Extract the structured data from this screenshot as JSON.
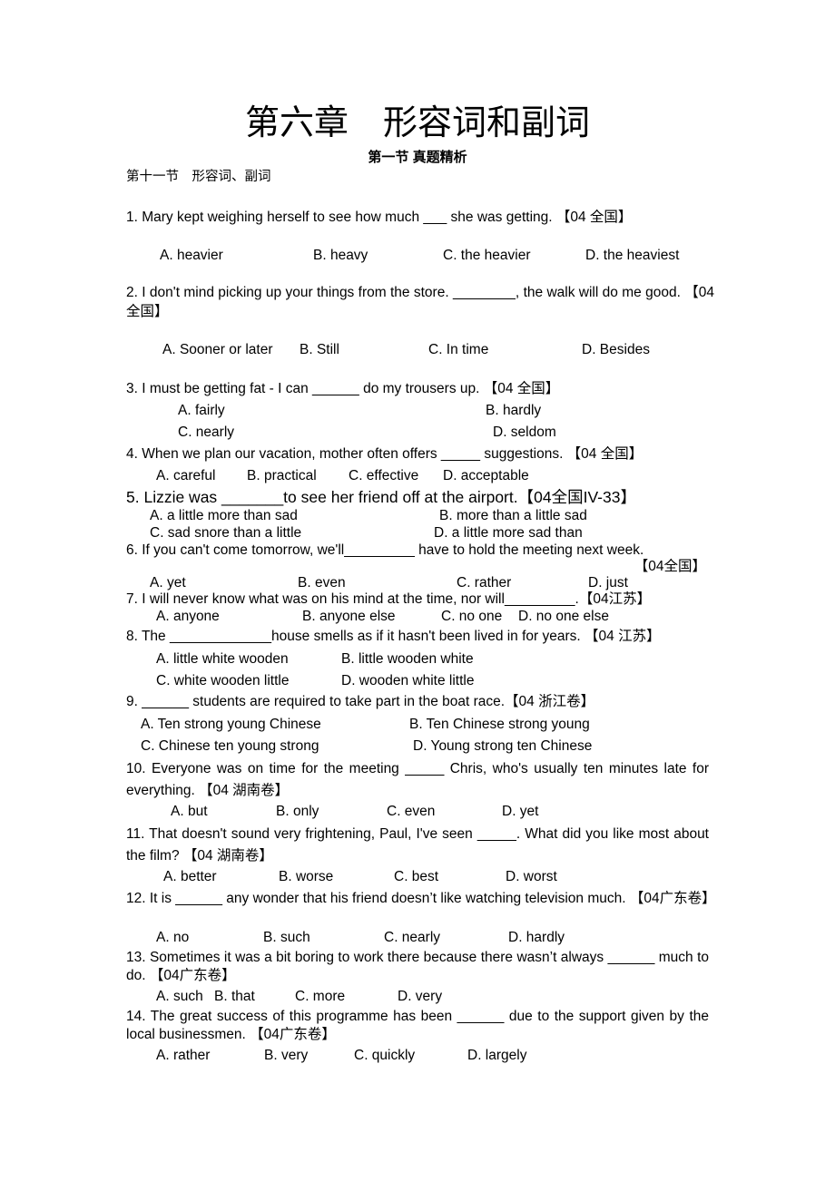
{
  "header": {
    "title": "第六章　形容词和副词",
    "subtitle": "第一节 真题精析",
    "section": "第十一节　形容词、副词"
  },
  "questions": [
    {
      "stem": "1. Mary kept weighing herself to see how much ___ she was getting.  【04 全国】",
      "options": [
        "A. heavier",
        "B. heavy",
        "C. the heavier",
        "D. the heaviest"
      ]
    },
    {
      "stem": "2. I don't mind picking up your things from the store. ________, the walk will do me good. 【04 全国】",
      "options": [
        "A. Sooner or later",
        "B. Still",
        "C. In time",
        "D. Besides"
      ]
    },
    {
      "stem": "3. I must be getting fat - I can ______ do my trousers up.  【04 全国】",
      "options": [
        "A. fairly",
        "B. hardly",
        "C. nearly",
        "D. seldom"
      ]
    },
    {
      "stem": "4. When we plan our vacation, mother often offers _____ suggestions.  【04 全国】",
      "options": [
        "A. careful",
        "B. practical",
        "C. effective",
        "D. acceptable"
      ]
    },
    {
      "stem": "5. Lizzie was _______to see her friend off at the airport.【04全国IV-33】",
      "options": [
        "A. a little more than sad",
        "B. more than a little sad",
        "C. sad snore than a little",
        "D. a little more sad than"
      ]
    },
    {
      "stem": "6.  If you can't come tomorrow, we'll_________ have to hold the meeting next week.",
      "source": "【04全国】",
      "options": [
        "A. yet",
        "B. even",
        "C. rather",
        "D. just"
      ]
    },
    {
      "stem": "7. I will never know what was on his mind at the time, nor will_________.【04江苏】",
      "options": [
        "A. anyone",
        "B. anyone else",
        "C. no one",
        "D. no one else"
      ]
    },
    {
      "stem": "8. The _____________house smells as if it hasn't been lived in for years.  【04 江苏】",
      "options": [
        "A. little white wooden",
        "B. little wooden white",
        "C. white wooden little",
        "D. wooden white little"
      ]
    },
    {
      "stem": "9. ______ students are required to take part in the boat race.【04 浙江卷】",
      "options": [
        "A. Ten strong young Chinese",
        "B. Ten Chinese strong young",
        "C. Chinese ten young strong",
        "D. Young strong ten Chinese"
      ]
    },
    {
      "stem": "10. Everyone was on time for the meeting _____ Chris, who's usually ten minutes late for everything.  【04 湖南卷】",
      "options": [
        "A. but",
        "B. only",
        "C. even",
        "D. yet"
      ]
    },
    {
      "stem": "11. That doesn't sound very frightening, Paul, I've seen _____. What did you like most about the film?  【04 湖南卷】",
      "options": [
        "A. better",
        "B. worse",
        "C. best",
        "D. worst"
      ]
    },
    {
      "stem": "12. It is ______ any wonder that his friend doesn’t like watching television much.  【04广东卷】",
      "options": [
        "A. no",
        "B. such",
        "C. nearly",
        "D. hardly"
      ]
    },
    {
      "stem": "13. Sometimes it was a bit boring to work there because there wasn’t always ______ much to do.  【04广东卷】",
      "options": [
        "A. such",
        "B. that",
        "C. more",
        "D. very"
      ]
    },
    {
      "stem": "14. The great success of this programme has been ______ due to the support given by the local businessmen.  【04广东卷】",
      "options": [
        "A. rather",
        "B. very",
        "C. quickly",
        "D. largely"
      ]
    }
  ]
}
